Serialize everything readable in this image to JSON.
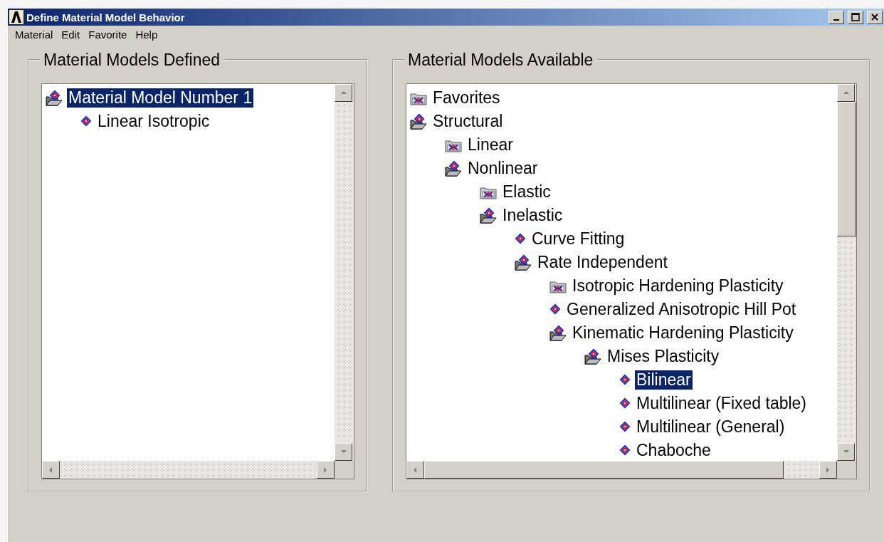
{
  "window": {
    "title": "Define Material Model Behavior"
  },
  "menu": [
    "Material",
    "Edit",
    "Favorite",
    "Help"
  ],
  "defined": {
    "title": "Material Models Defined",
    "tree": [
      {
        "label": "Material Model Number 1",
        "kind": "folder-open",
        "selected": true,
        "children": [
          {
            "label": "Linear Isotropic",
            "kind": "model",
            "selected": false
          }
        ]
      }
    ]
  },
  "available": {
    "title": "Material Models Available",
    "tree": [
      {
        "label": "Favorites",
        "kind": "folder-closed",
        "selected": false
      },
      {
        "label": "Structural",
        "kind": "folder-open",
        "selected": false,
        "children": [
          {
            "label": "Linear",
            "kind": "folder-closed",
            "selected": false
          },
          {
            "label": "Nonlinear",
            "kind": "folder-open",
            "selected": false,
            "children": [
              {
                "label": "Elastic",
                "kind": "folder-closed",
                "selected": false
              },
              {
                "label": "Inelastic",
                "kind": "folder-open",
                "selected": false,
                "children": [
                  {
                    "label": "Curve Fitting",
                    "kind": "model",
                    "selected": false
                  },
                  {
                    "label": "Rate Independent",
                    "kind": "folder-open",
                    "selected": false,
                    "children": [
                      {
                        "label": "Isotropic Hardening Plasticity",
                        "kind": "folder-closed",
                        "selected": false
                      },
                      {
                        "label": "Generalized Anisotropic Hill Pot",
                        "kind": "model",
                        "selected": false
                      },
                      {
                        "label": "Kinematic Hardening Plasticity",
                        "kind": "folder-open",
                        "selected": false,
                        "children": [
                          {
                            "label": "Mises Plasticity",
                            "kind": "folder-open",
                            "selected": false,
                            "children": [
                              {
                                "label": "Bilinear",
                                "kind": "model",
                                "selected": true
                              },
                              {
                                "label": "Multilinear (Fixed table)",
                                "kind": "model",
                                "selected": false
                              },
                              {
                                "label": "Multilinear (General)",
                                "kind": "model",
                                "selected": false
                              },
                              {
                                "label": "Chaboche",
                                "kind": "model",
                                "selected": false
                              }
                            ]
                          }
                        ]
                      }
                    ]
                  }
                ]
              }
            ]
          }
        ]
      }
    ]
  }
}
